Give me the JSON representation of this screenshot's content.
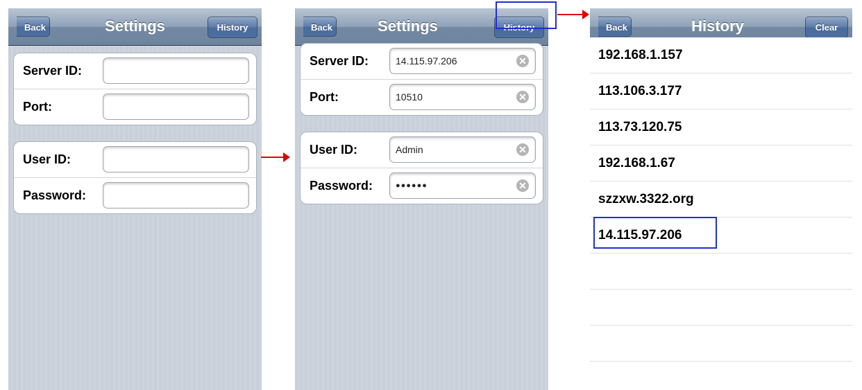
{
  "screen1": {
    "nav": {
      "back": "Back",
      "title": "Settings",
      "right_button": "History"
    },
    "group1": [
      {
        "label": "Server ID:",
        "value": ""
      },
      {
        "label": "Port:",
        "value": ""
      }
    ],
    "group2": [
      {
        "label": "User ID:",
        "value": ""
      },
      {
        "label": "Password:",
        "value": ""
      }
    ]
  },
  "screen2": {
    "nav": {
      "back": "Back",
      "title": "Settings",
      "right_button": "History"
    },
    "group1": [
      {
        "label": "Server ID:",
        "value": "14.115.97.206"
      },
      {
        "label": "Port:",
        "value": "10510"
      }
    ],
    "group2": [
      {
        "label": "User ID:",
        "value": "Admin"
      },
      {
        "label": "Password:",
        "value": "●●●●●●"
      }
    ],
    "clear_icon_glyph": "✕"
  },
  "screen3": {
    "nav": {
      "back": "Back",
      "title": "History",
      "right_button": "Clear"
    },
    "items": [
      "192.168.1.157",
      "113.106.3.177",
      "113.73.120.75",
      "192.168.1.67",
      "szzxw.3322.org",
      "14.115.97.206",
      "",
      "",
      ""
    ]
  },
  "colors": {
    "highlight": "#1f2ed6",
    "arrow": "#e00000"
  }
}
